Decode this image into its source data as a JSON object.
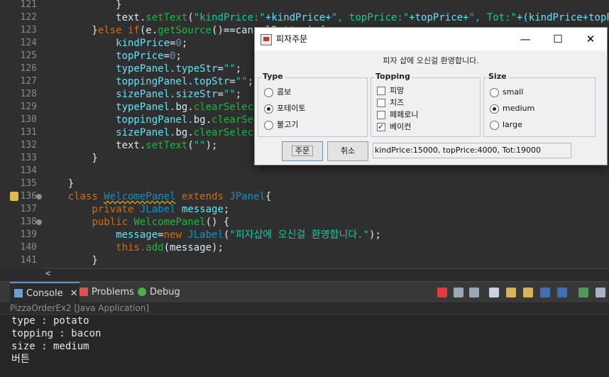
{
  "editor": {
    "lines": [
      {
        "n": "121",
        "segs": [
          {
            "t": "            }",
            "c": "pl"
          }
        ]
      },
      {
        "n": "122",
        "segs": [
          {
            "t": "            text.",
            "c": "pl"
          },
          {
            "t": "setText",
            "c": "fn"
          },
          {
            "t": "(",
            "c": "pl"
          },
          {
            "t": "\"kindPrice:\"",
            "c": "st"
          },
          {
            "t": "+kindPrice+",
            "c": "fd"
          },
          {
            "t": "\", topPrice:\"",
            "c": "st"
          },
          {
            "t": "+topPrice+",
            "c": "fd"
          },
          {
            "t": "\", Tot:\"",
            "c": "st"
          },
          {
            "t": "+(kindPrice+topPrice)",
            "c": "fd"
          }
        ]
      },
      {
        "n": "123",
        "segs": [
          {
            "t": "        }",
            "c": "pl"
          },
          {
            "t": "else if",
            "c": "kw"
          },
          {
            "t": "(e.",
            "c": "pl"
          },
          {
            "t": "getSource",
            "c": "fn"
          },
          {
            "t": "()==cancelButton) {",
            "c": "pl"
          }
        ]
      },
      {
        "n": "124",
        "segs": [
          {
            "t": "            kindPrice",
            "c": "fd"
          },
          {
            "t": "=",
            "c": "pl"
          },
          {
            "t": "0",
            "c": "num"
          },
          {
            "t": ";",
            "c": "pl"
          }
        ]
      },
      {
        "n": "125",
        "segs": [
          {
            "t": "            topPrice",
            "c": "fd"
          },
          {
            "t": "=",
            "c": "pl"
          },
          {
            "t": "0",
            "c": "num"
          },
          {
            "t": ";",
            "c": "pl"
          }
        ]
      },
      {
        "n": "126",
        "segs": [
          {
            "t": "            typePanel.",
            "c": "fd"
          },
          {
            "t": "typeStr",
            "c": "fd"
          },
          {
            "t": "=",
            "c": "pl"
          },
          {
            "t": "\"\"",
            "c": "st"
          },
          {
            "t": ";",
            "c": "pl"
          }
        ]
      },
      {
        "n": "127",
        "segs": [
          {
            "t": "            toppingPanel.",
            "c": "fd"
          },
          {
            "t": "topStr",
            "c": "fd"
          },
          {
            "t": "=",
            "c": "pl"
          },
          {
            "t": "\"\"",
            "c": "st"
          },
          {
            "t": ";",
            "c": "pl"
          }
        ]
      },
      {
        "n": "128",
        "segs": [
          {
            "t": "            sizePanel.",
            "c": "fd"
          },
          {
            "t": "sizeStr",
            "c": "fd"
          },
          {
            "t": "=",
            "c": "pl"
          },
          {
            "t": "\"\"",
            "c": "st"
          },
          {
            "t": ";",
            "c": "pl"
          }
        ]
      },
      {
        "n": "129",
        "segs": [
          {
            "t": "            typePanel.",
            "c": "fd"
          },
          {
            "t": "bg.",
            "c": "pl"
          },
          {
            "t": "clearSelection",
            "c": "fn"
          },
          {
            "t": "();",
            "c": "pl"
          }
        ]
      },
      {
        "n": "130",
        "segs": [
          {
            "t": "            toppingPanel.",
            "c": "fd"
          },
          {
            "t": "bg.",
            "c": "pl"
          },
          {
            "t": "clearSelection",
            "c": "fn"
          },
          {
            "t": "();",
            "c": "pl"
          }
        ]
      },
      {
        "n": "131",
        "segs": [
          {
            "t": "            sizePanel.",
            "c": "fd"
          },
          {
            "t": "bg.",
            "c": "pl"
          },
          {
            "t": "clearSelection",
            "c": "fn"
          },
          {
            "t": "();",
            "c": "pl"
          }
        ]
      },
      {
        "n": "132",
        "segs": [
          {
            "t": "            text.",
            "c": "pl"
          },
          {
            "t": "setText",
            "c": "fn"
          },
          {
            "t": "(",
            "c": "pl"
          },
          {
            "t": "\"\"",
            "c": "st"
          },
          {
            "t": ");",
            "c": "pl"
          }
        ]
      },
      {
        "n": "133",
        "segs": [
          {
            "t": "        }",
            "c": "pl"
          }
        ]
      },
      {
        "n": "134",
        "segs": []
      },
      {
        "n": "135",
        "segs": [
          {
            "t": "    }",
            "c": "pl"
          }
        ]
      },
      {
        "n": "136",
        "marker": true,
        "warn": true,
        "segs": [
          {
            "t": "    ",
            "c": "pl"
          },
          {
            "t": "class ",
            "c": "kw"
          },
          {
            "t": "WelcomePanel",
            "c": "cl",
            "sq": true
          },
          {
            "t": " extends ",
            "c": "kw"
          },
          {
            "t": "JPanel",
            "c": "cl"
          },
          {
            "t": "{",
            "c": "pl"
          }
        ]
      },
      {
        "n": "137",
        "segs": [
          {
            "t": "        ",
            "c": "pl"
          },
          {
            "t": "private ",
            "c": "kw"
          },
          {
            "t": "JLabel ",
            "c": "cl"
          },
          {
            "t": "message",
            "c": "fd"
          },
          {
            "t": ";",
            "c": "pl"
          }
        ]
      },
      {
        "n": "138",
        "marker": true,
        "segs": [
          {
            "t": "        ",
            "c": "pl"
          },
          {
            "t": "public ",
            "c": "kw"
          },
          {
            "t": "WelcomePanel",
            "c": "fn"
          },
          {
            "t": "() {",
            "c": "pl"
          }
        ]
      },
      {
        "n": "139",
        "segs": [
          {
            "t": "            message",
            "c": "fd"
          },
          {
            "t": "=",
            "c": "pl"
          },
          {
            "t": "new ",
            "c": "kw"
          },
          {
            "t": "JLabel",
            "c": "cl"
          },
          {
            "t": "(",
            "c": "pl"
          },
          {
            "t": "\"피자샵에 오신걸 환영합니다.\"",
            "c": "st"
          },
          {
            "t": ");",
            "c": "pl"
          }
        ]
      },
      {
        "n": "140",
        "segs": [
          {
            "t": "            this.",
            "c": "kw"
          },
          {
            "t": "add",
            "c": "fn"
          },
          {
            "t": "(message);",
            "c": "pl"
          }
        ]
      },
      {
        "n": "141",
        "segs": [
          {
            "t": "        }",
            "c": "pl"
          }
        ]
      }
    ],
    "scroll_arrow": "<"
  },
  "console": {
    "tabs": [
      {
        "label": "Console",
        "close": "✕",
        "icon": "console-icon",
        "color": "#6aa0d8"
      },
      {
        "label": "Problems",
        "icon": "problems-icon",
        "color": "#d9534f"
      },
      {
        "label": "Debug",
        "icon": "debug-icon",
        "color": "#4caf50"
      }
    ],
    "title": "PizzaOrderEx2 [Java Application]",
    "output": [
      "type : potato",
      "topping : bacon",
      "size : medium",
      "버튼"
    ]
  },
  "dialog": {
    "title": "피자주문",
    "minimize": "—",
    "maximize": "☐",
    "close": "✕",
    "welcome": "피자 샵에 오신걸 환영합니다.",
    "type": {
      "legend": "Type",
      "options": [
        {
          "label": "콤보",
          "checked": false
        },
        {
          "label": "포테이토",
          "checked": true
        },
        {
          "label": "불고기",
          "checked": false
        }
      ]
    },
    "topping": {
      "legend": "Topping",
      "options": [
        {
          "label": "피망",
          "checked": false
        },
        {
          "label": "치즈",
          "checked": false
        },
        {
          "label": "페페로니",
          "checked": false
        },
        {
          "label": "베이컨",
          "checked": true
        }
      ]
    },
    "size": {
      "legend": "Size",
      "options": [
        {
          "label": "small",
          "checked": false
        },
        {
          "label": "medium",
          "checked": true
        },
        {
          "label": "large",
          "checked": false
        }
      ]
    },
    "order_button": "주문",
    "cancel_button": "취소",
    "result": "kindPrice:15000, topPrice:4000, Tot:19000"
  }
}
